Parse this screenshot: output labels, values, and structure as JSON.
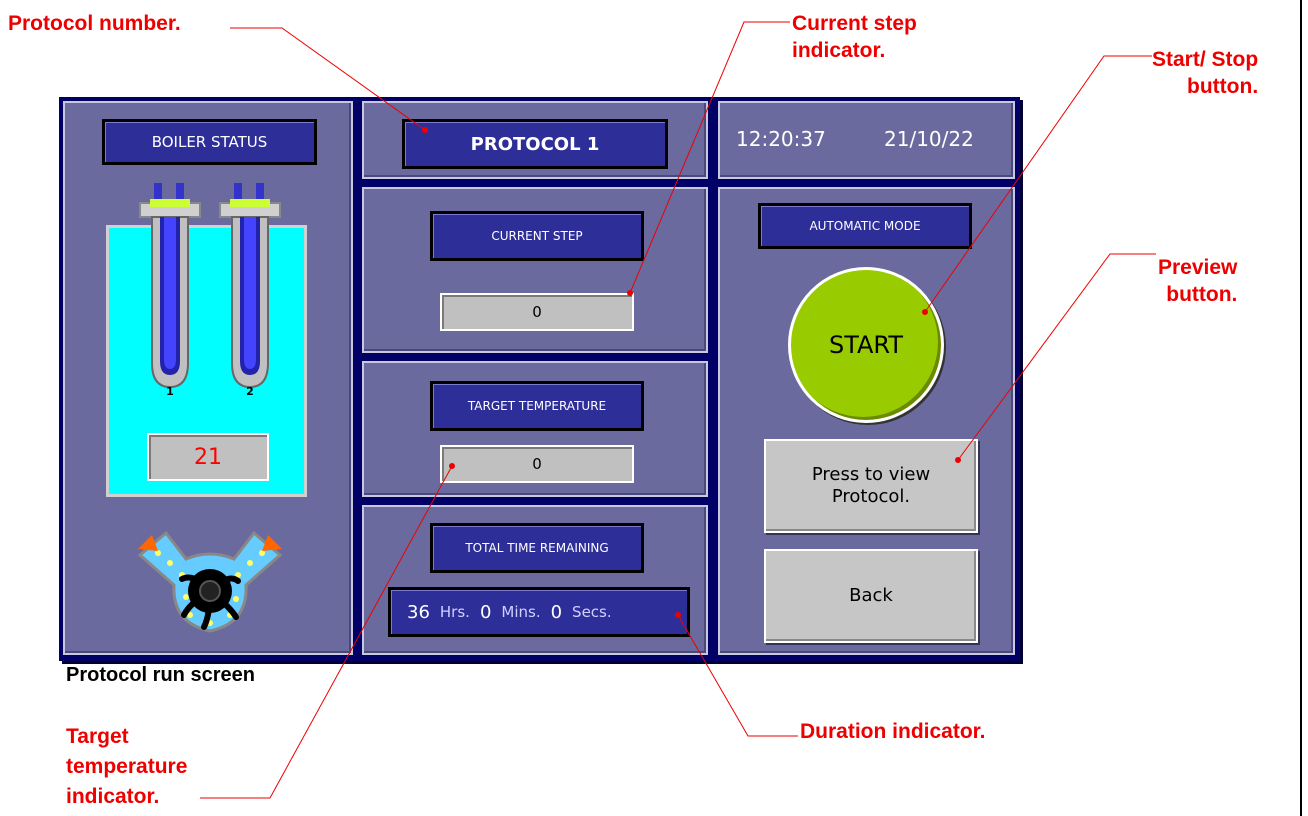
{
  "annotations": {
    "protocol_number": "Protocol number.",
    "current_step": "Current step\nindicator.",
    "start_stop": "Start/ Stop\nbutton.",
    "preview": "Preview\nbutton.",
    "duration": "Duration indicator.",
    "target_temperature": "Target\ntemperature\nindicator."
  },
  "caption": "Protocol run screen",
  "screen": {
    "boiler": {
      "title": "BOILER STATUS",
      "heater_labels": [
        "1",
        "2"
      ],
      "temperature": "21"
    },
    "protocol_title": "PROTOCOL 1",
    "clock": {
      "time": "12:20:37",
      "date": "21/10/22"
    },
    "current_step": {
      "label": "CURRENT STEP",
      "value": "0"
    },
    "target_temperature": {
      "label": "TARGET TEMPERATURE",
      "value": "0"
    },
    "time_remaining": {
      "label": "TOTAL TIME REMAINING",
      "hours": "36",
      "hours_unit": "Hrs.",
      "mins": "0",
      "mins_unit": "Mins.",
      "secs": "0",
      "secs_unit": "Secs."
    },
    "mode_label": "AUTOMATIC MODE",
    "start_button": "START",
    "preview_button": "Press to view\nProtocol.",
    "back_button": "Back"
  },
  "colors": {
    "screen_bg": "#000066",
    "panel": "#6a6a9e",
    "label_box": "#2e2e99",
    "water": "#00ffff",
    "start_green": "#99cc00",
    "annotation_red": "#ee0000",
    "temperature_red": "#ff0000"
  },
  "icons": [
    "heater-element-icon",
    "pump-icon"
  ]
}
